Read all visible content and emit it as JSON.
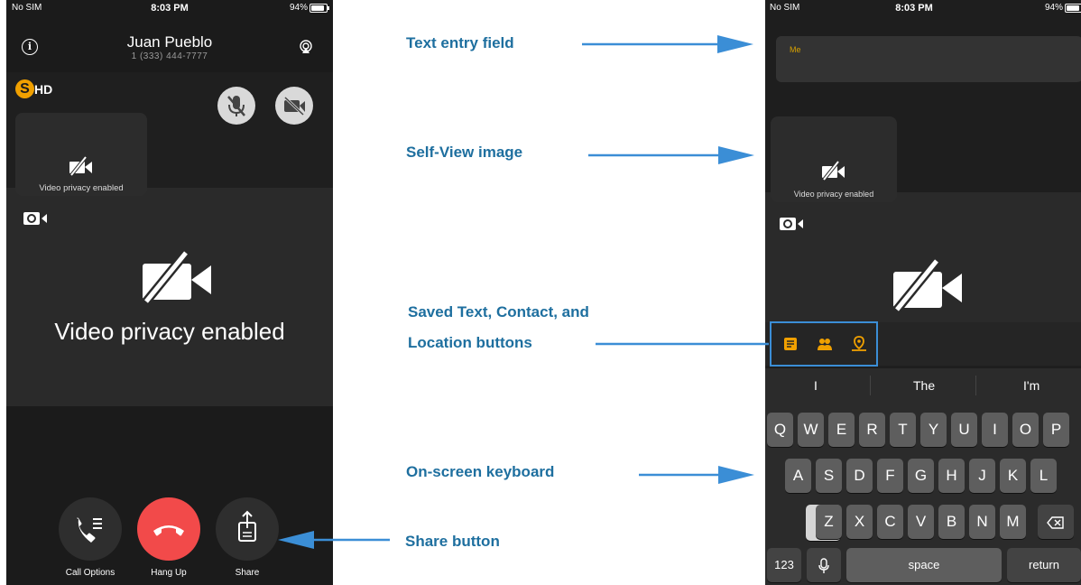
{
  "left_phone": {
    "status": {
      "carrier": "No SIM",
      "time": "8:03 PM",
      "battery": "94%"
    },
    "caller": {
      "name": "Juan Pueblo",
      "number": "1 (333) 444-7777"
    },
    "logo": {
      "s": "S",
      "hd": "HD"
    },
    "selfview_text": "Video privacy enabled",
    "main_privacy_text": "Video privacy enabled",
    "buttons": {
      "call_options": "Call Options",
      "hang_up": "Hang Up",
      "share": "Share"
    }
  },
  "right_phone": {
    "status": {
      "carrier": "No SIM",
      "time": "8:03 PM",
      "battery": "94%"
    },
    "text_field_placeholder": "Me",
    "selfview_text": "Video privacy enabled",
    "suggestions": [
      "I",
      "The",
      "I'm"
    ],
    "keyboard": {
      "row1": [
        "Q",
        "W",
        "E",
        "R",
        "T",
        "Y",
        "U",
        "I",
        "O",
        "P"
      ],
      "row2": [
        "A",
        "S",
        "D",
        "F",
        "G",
        "H",
        "J",
        "K",
        "L"
      ],
      "row3": [
        "Z",
        "X",
        "C",
        "V",
        "B",
        "N",
        "M"
      ],
      "numbers": "123",
      "space": "space",
      "return": "return"
    }
  },
  "callouts": {
    "text_entry": "Text entry field",
    "self_view": "Self-View image",
    "saved_line1": "Saved Text, Contact, and",
    "saved_line2": "Location buttons",
    "keyboard": "On-screen keyboard",
    "share": "Share button"
  },
  "colors": {
    "accent": "#f0a000",
    "hangup": "#f24a4a",
    "callout": "#1e6f9f",
    "arrow": "#3b8ed6"
  }
}
